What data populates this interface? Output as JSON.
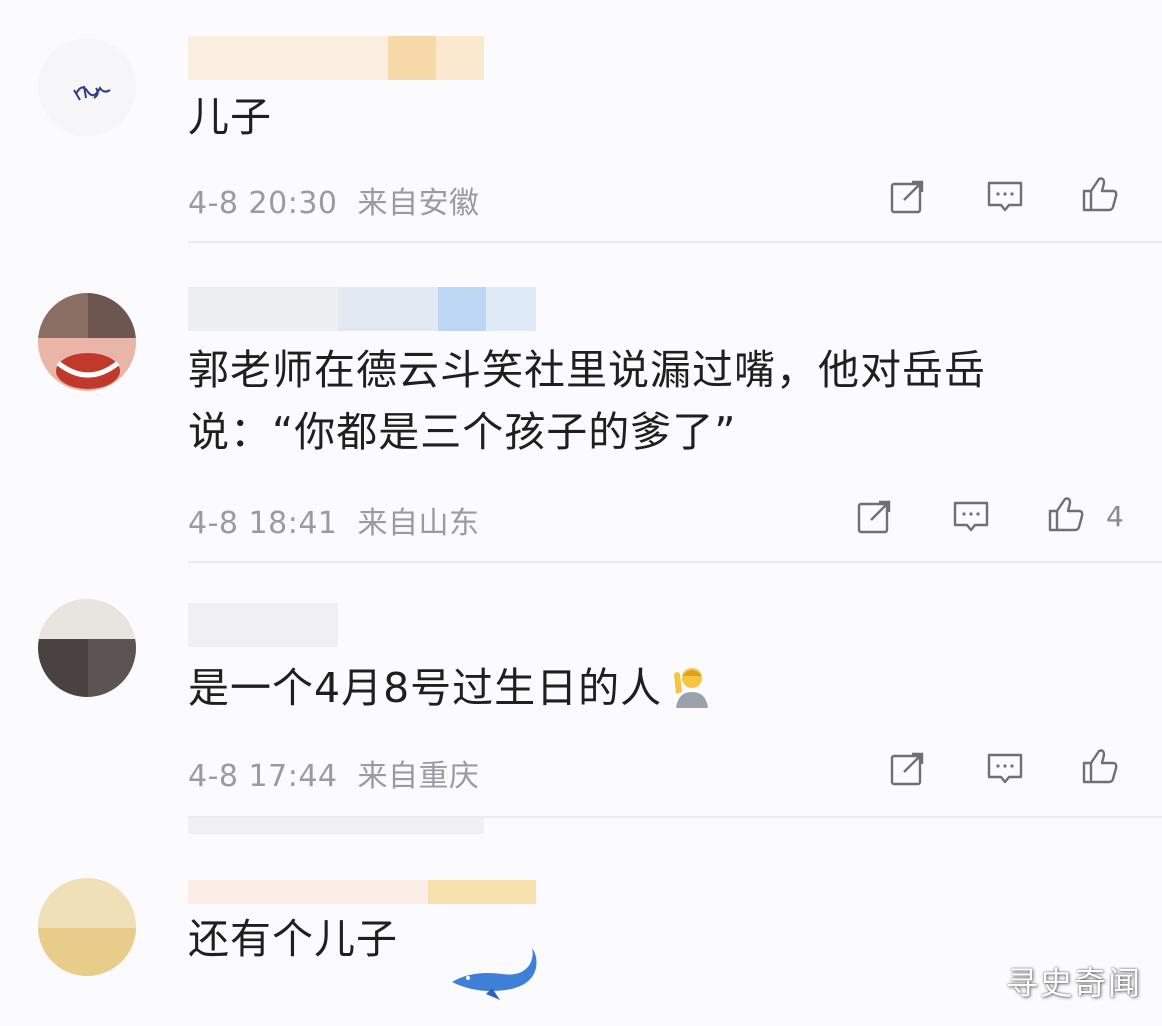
{
  "comments": [
    {
      "text": "儿子",
      "time": "4-8 20:30",
      "location": "来自安徽",
      "likes": ""
    },
    {
      "text_line1": "郭老师在德云斗笑社里说漏过嘴，他对岳岳",
      "text_line2": "说：“你都是三个孩子的爹了”",
      "time": "4-8 18:41",
      "location": "来自山东",
      "likes": "4"
    },
    {
      "text": "是一个4月8号过生日的人",
      "time": "4-8 17:44",
      "location": "来自重庆",
      "likes": ""
    },
    {
      "text": "还有个儿子"
    }
  ],
  "watermark": "寻史奇闻",
  "colors": {
    "meta": "#9a9aa2",
    "icon": "#6f6f78",
    "divider": "#ececf0"
  },
  "icons": [
    "repost-icon",
    "comment-icon",
    "like-icon"
  ]
}
